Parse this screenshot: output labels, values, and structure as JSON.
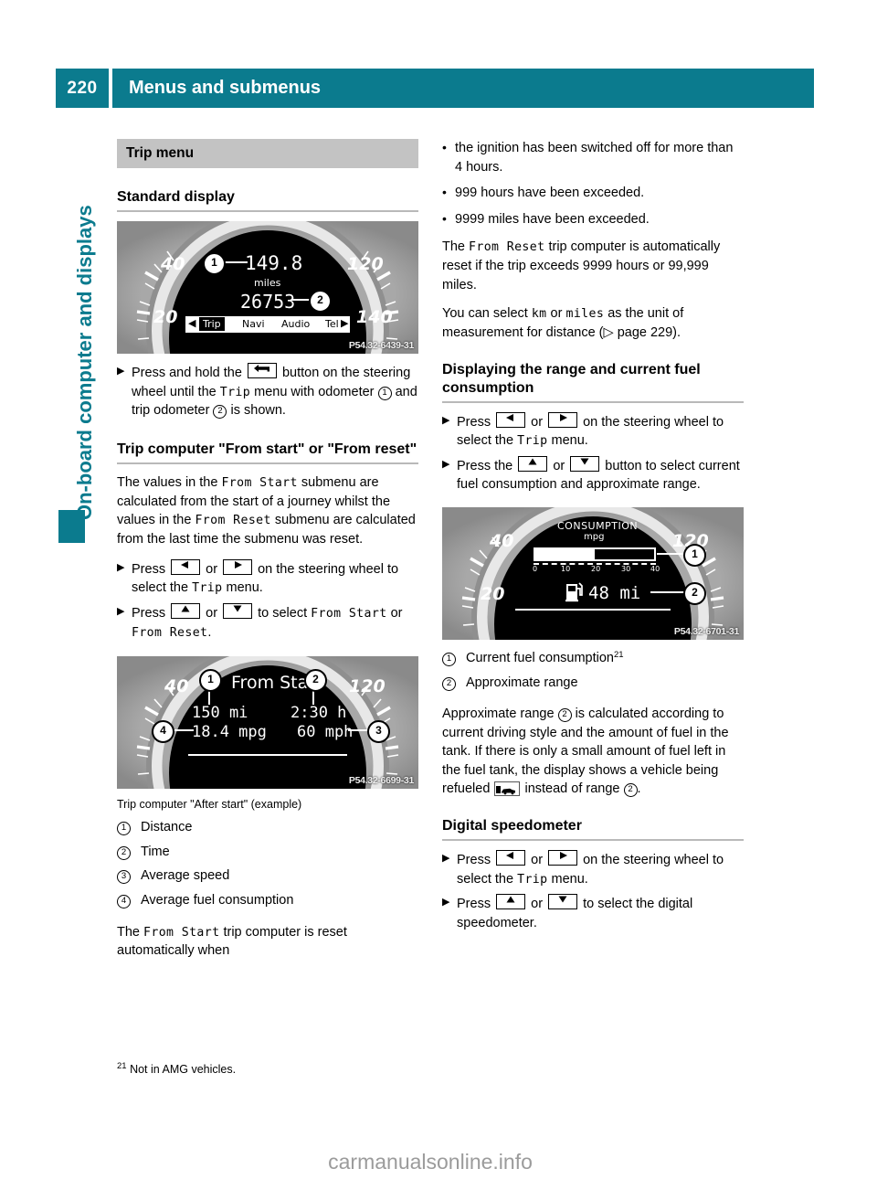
{
  "header": {
    "page_number": "220",
    "title": "Menus and submenus"
  },
  "sidebar": {
    "chapter_label": "On-board computer and displays"
  },
  "left_column": {
    "section_bar": "Trip menu",
    "heading_standard_display": "Standard display",
    "figure1": {
      "code": "P54.32-6439-31",
      "odometer": "149.8",
      "unit": "miles",
      "trip_odometer": "26753",
      "menu_items": [
        "Trip",
        "Navi",
        "Audio",
        "Tel"
      ],
      "selected_menu": "Trip",
      "tick_labels": [
        "40",
        "20",
        "120",
        "140"
      ],
      "callouts": [
        "1",
        "2"
      ]
    },
    "step1": {
      "pre": "Press and hold the",
      "mid": "button on the steering wheel until the",
      "mono1": "Trip",
      "post1": "menu with odometer",
      "post2": "and trip odometer",
      "post3": "is shown.",
      "key_icon": "back-arrow-key"
    },
    "heading_trip_computer": "Trip computer \"From start\" or \"From reset\"",
    "para_values": {
      "p1": "The values in the",
      "m1": "From Start",
      "p2": "submenu are calculated from the start of a journey whilst the values in the",
      "m2": "From Reset",
      "p3": "submenu are calculated from the last time the submenu was reset."
    },
    "step2": {
      "pre": "Press",
      "or": "or",
      "mid": "on the steering wheel to select the",
      "mono": "Trip",
      "post": "menu."
    },
    "step3": {
      "pre": "Press",
      "or": "or",
      "mid": "to select",
      "mono1": "From Start",
      "orword": "or",
      "mono2": "From Reset",
      "post": "."
    },
    "figure2": {
      "code": "P54.32-6699-31",
      "title": "From Start",
      "distance": "150 mi",
      "time": "2:30 h",
      "consumption": "18.4 mpg",
      "speed": "60 mph",
      "tick_labels": [
        "40",
        "120"
      ],
      "callouts": [
        "1",
        "2",
        "3",
        "4"
      ]
    },
    "figure2_caption": "Trip computer \"After start\" (example)",
    "legend1": [
      {
        "num": "1",
        "label": "Distance"
      },
      {
        "num": "2",
        "label": "Time"
      },
      {
        "num": "3",
        "label": "Average speed"
      },
      {
        "num": "4",
        "label": "Average fuel consumption"
      }
    ],
    "para_reset": {
      "p1": "The",
      "m1": "From Start",
      "p2": "trip computer is reset automatically when"
    }
  },
  "right_column": {
    "bullets": [
      "the ignition has been switched off for more than 4 hours.",
      "999 hours have been exceeded.",
      "9999 miles have been exceeded."
    ],
    "para_from_reset": {
      "p1": "The",
      "m1": "From Reset",
      "p2": "trip computer is automatically reset if the trip exceeds 9999 hours or 99,999 miles."
    },
    "para_units": {
      "p1": "You can select",
      "m1": "km",
      "p2": "or",
      "m2": "miles",
      "p3": "as the unit of measurement for distance (",
      "p4": "page 229)."
    },
    "heading_range": "Displaying the range and current fuel consumption",
    "step1": {
      "pre": "Press",
      "or": "or",
      "mid": "on the steering wheel to select the",
      "mono": "Trip",
      "post": "menu."
    },
    "step2": {
      "pre": "Press the",
      "or": "or",
      "mid": "button to select current fuel consumption and approximate range."
    },
    "figure3": {
      "code": "P54.32-6701-31",
      "title": "CONSUMPTION",
      "subtitle": "mpg",
      "scale_labels": [
        "0",
        "10",
        "20",
        "30",
        "40"
      ],
      "bar_value": 20,
      "bar_max": 40,
      "range_text": "48 mi",
      "tick_labels": [
        "40",
        "20",
        "120"
      ],
      "callouts": [
        "1",
        "2"
      ]
    },
    "legend2": [
      {
        "num": "1",
        "label": "Current fuel consumption",
        "footnote": "21"
      },
      {
        "num": "2",
        "label": "Approximate range"
      }
    ],
    "para_range": {
      "p1": "Approximate range",
      "p2": "is calculated according to current driving style and the amount of fuel in the tank. If there is only a small amount of fuel left in the fuel tank, the display shows a vehicle being refueled",
      "p3": "instead of range",
      "p4": "."
    },
    "heading_speedo": "Digital speedometer",
    "step3": {
      "pre": "Press",
      "or": "or",
      "mid": "on the steering wheel to select the",
      "mono": "Trip",
      "post": "menu."
    },
    "step4": {
      "pre": "Press",
      "or": "or",
      "mid": "to select the digital speedometer."
    }
  },
  "footnote": {
    "marker": "21",
    "text": "Not in AMG vehicles."
  },
  "watermark": "carmanualsonline.info",
  "colors": {
    "accent_teal": "#0b7b8e",
    "grey_bar": "#c3c3c3"
  }
}
